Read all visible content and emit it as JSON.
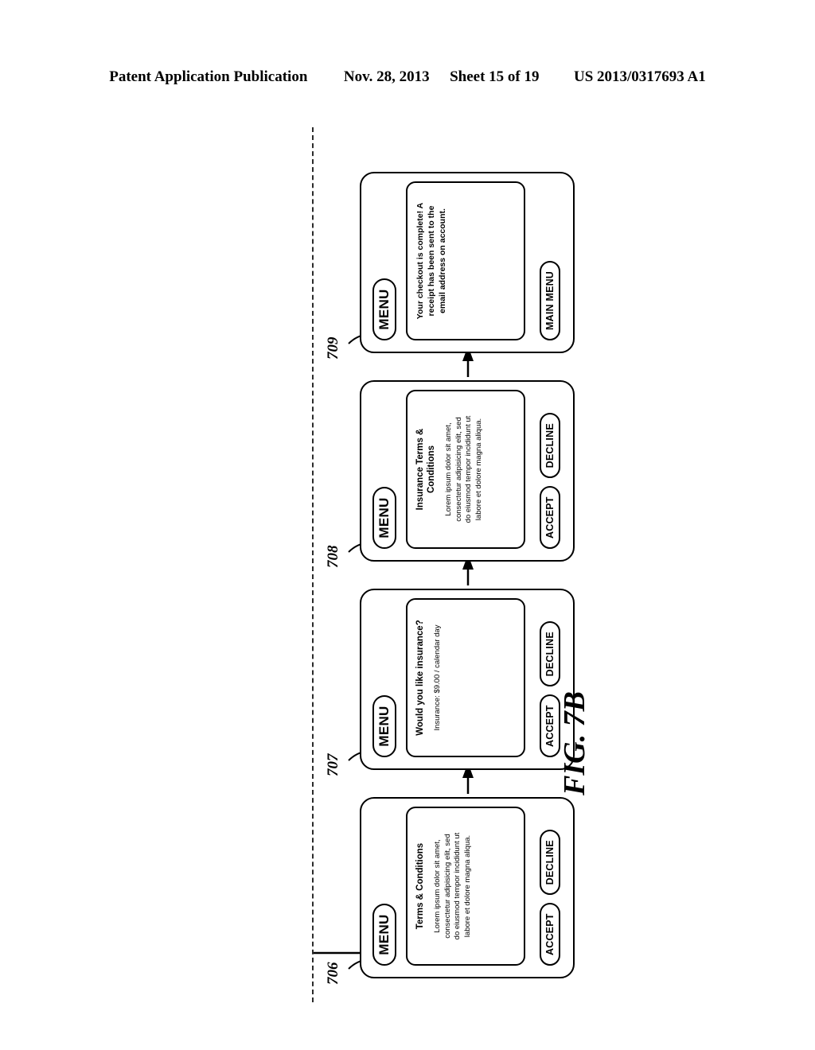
{
  "header": {
    "publication": "Patent Application Publication",
    "date": "Nov. 28, 2013",
    "sheet": "Sheet 15 of 19",
    "patent_number": "US 2013/0317693 A1"
  },
  "figure": {
    "caption": "FIG. 7B",
    "menu_label": "MENU"
  },
  "screens": [
    {
      "ref": "706",
      "menu": "MENU",
      "title": "Terms & Conditions",
      "body": "Lorem ipsum dolor sit amet,\nconsectetur adipisicing elit, sed\ndo eiusmod tempor incididunt ut\nlabore et dolore magna aliqua.",
      "buttons": [
        "ACCEPT",
        "DECLINE"
      ]
    },
    {
      "ref": "707",
      "menu": "MENU",
      "title": "Would you like insurance?",
      "body": "Insurance:  $9.00 / calendar day",
      "buttons": [
        "ACCEPT",
        "DECLINE"
      ]
    },
    {
      "ref": "708",
      "menu": "MENU",
      "title": "Insurance Terms &\nConditions",
      "body": "Lorem ipsum dolor sit amet,\nconsectetur adipisicing elit, sed\ndo eiusmod tempor incididunt ut\nlabore et dolore magna aliqua.",
      "buttons": [
        "ACCEPT",
        "DECLINE"
      ]
    },
    {
      "ref": "709",
      "menu": "MENU",
      "title": "",
      "message": "Your checkout is complete! A\nreceipt has been sent to the\nemail address on account.",
      "buttons": [
        "MAIN MENU"
      ]
    }
  ],
  "colors": {
    "ink": "#000000",
    "paper": "#ffffff",
    "dashed": "#2b2b2b"
  }
}
